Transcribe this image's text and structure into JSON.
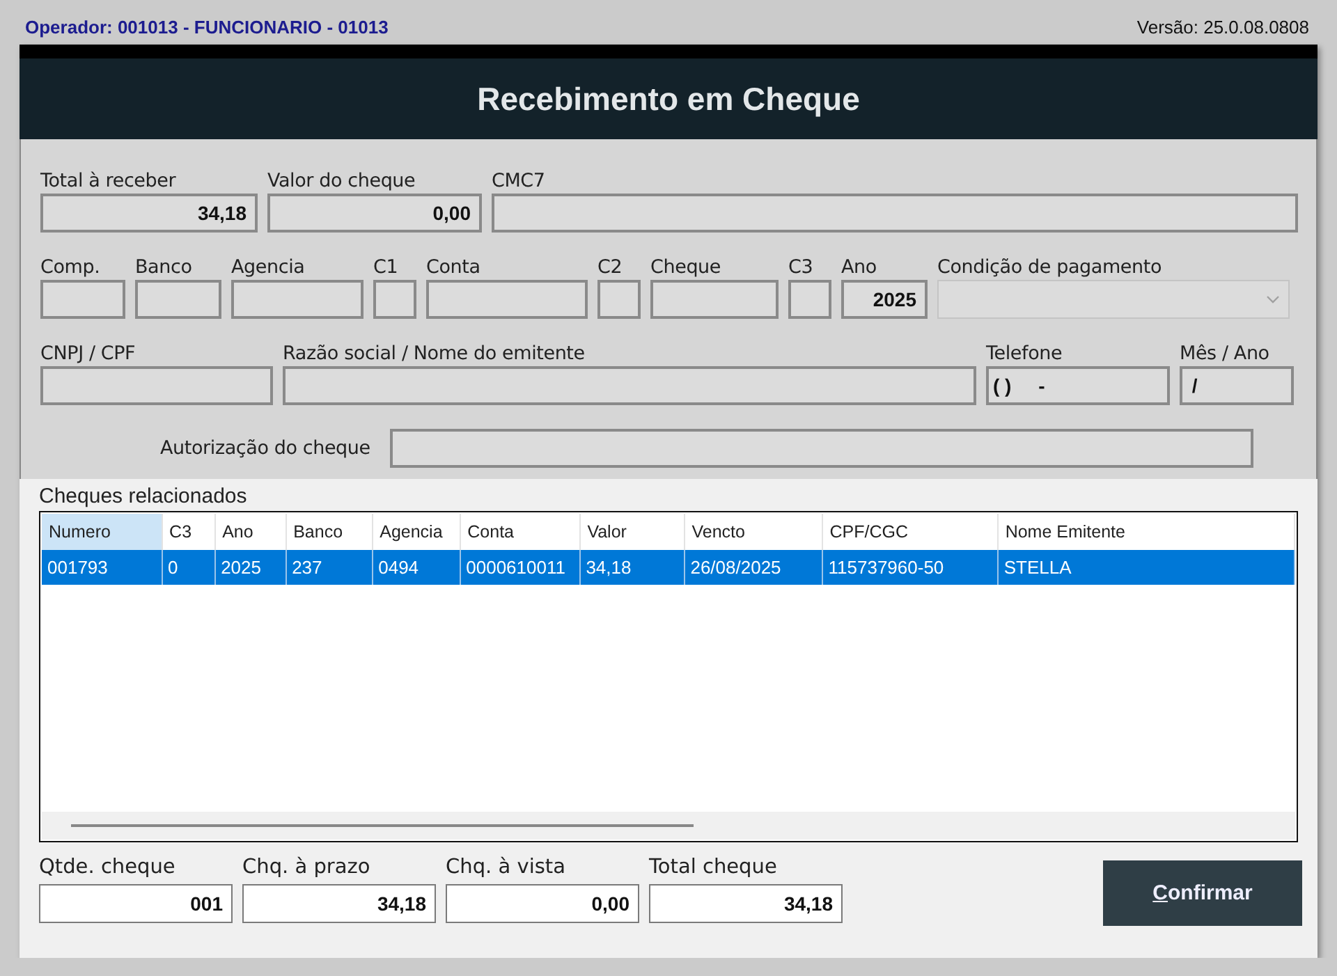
{
  "status": {
    "operator": "Operador: 001013 - FUNCIONARIO - 01013",
    "version": "Versão: 25.0.08.0808"
  },
  "window": {
    "title": "Recebimento em Cheque"
  },
  "form_rows": [
    {
      "fields": [
        {
          "label": "Total à receber",
          "value": "34,18",
          "kind": "number"
        },
        {
          "label": "Valor do cheque",
          "value": "0,00",
          "kind": "number"
        },
        {
          "label": "CMC7",
          "kind": "text"
        }
      ]
    },
    {
      "fields": [
        {
          "label": "Comp.",
          "kind": "text"
        },
        {
          "label": "Banco",
          "kind": "text"
        },
        {
          "label": "Agencia",
          "kind": "text"
        },
        {
          "label": "C1",
          "kind": "text"
        },
        {
          "label": "Conta",
          "kind": "text"
        },
        {
          "label": "C2",
          "kind": "text"
        },
        {
          "label": "Cheque",
          "kind": "text"
        },
        {
          "label": "C3",
          "kind": "text"
        },
        {
          "label": "Ano",
          "value": "2025",
          "kind": "number"
        },
        {
          "label": "Condição de pagamento",
          "kind": "combo",
          "disabled": true
        }
      ]
    },
    {
      "fields": [
        {
          "label": "CNPJ / CPF",
          "kind": "text"
        },
        {
          "label": "Razão social / Nome do emitente",
          "kind": "text"
        },
        {
          "label": "Telefone",
          "value": "( )     -",
          "kind": "text"
        },
        {
          "label": "Mês / Ano",
          "value": " /",
          "kind": "text"
        }
      ]
    }
  ],
  "authorization": {
    "label": "Autorização do cheque"
  },
  "cheques": {
    "title": "Cheques relacionados",
    "columns": [
      {
        "label": "Numero",
        "selected": true
      },
      {
        "label": "C3",
        "selected": false
      },
      {
        "label": "Ano",
        "selected": false
      },
      {
        "label": "Banco",
        "selected": false
      },
      {
        "label": "Agencia",
        "selected": false
      },
      {
        "label": "Conta",
        "selected": false
      },
      {
        "label": "Valor",
        "selected": false
      },
      {
        "label": "Vencto",
        "selected": false
      },
      {
        "label": "CPF/CGC",
        "selected": false
      },
      {
        "label": "Nome Emitente",
        "selected": false
      }
    ],
    "rows": [
      {
        "selected": true,
        "cells": [
          "001793",
          "0",
          "2025",
          "237",
          "0494",
          "0000610011",
          "34,18",
          "26/08/2025",
          "115737960-50",
          "STELLA"
        ]
      }
    ]
  },
  "totals": [
    {
      "label": "Qtde. cheque",
      "value": "001"
    },
    {
      "label": "Chq. à prazo",
      "value": "34,18"
    },
    {
      "label": "Chq. à vista",
      "value": "0,00"
    },
    {
      "label": "Total cheque",
      "value": "34,18"
    }
  ],
  "confirm_button": {
    "label": "Confirmar",
    "mnemonic_underlined": true
  }
}
